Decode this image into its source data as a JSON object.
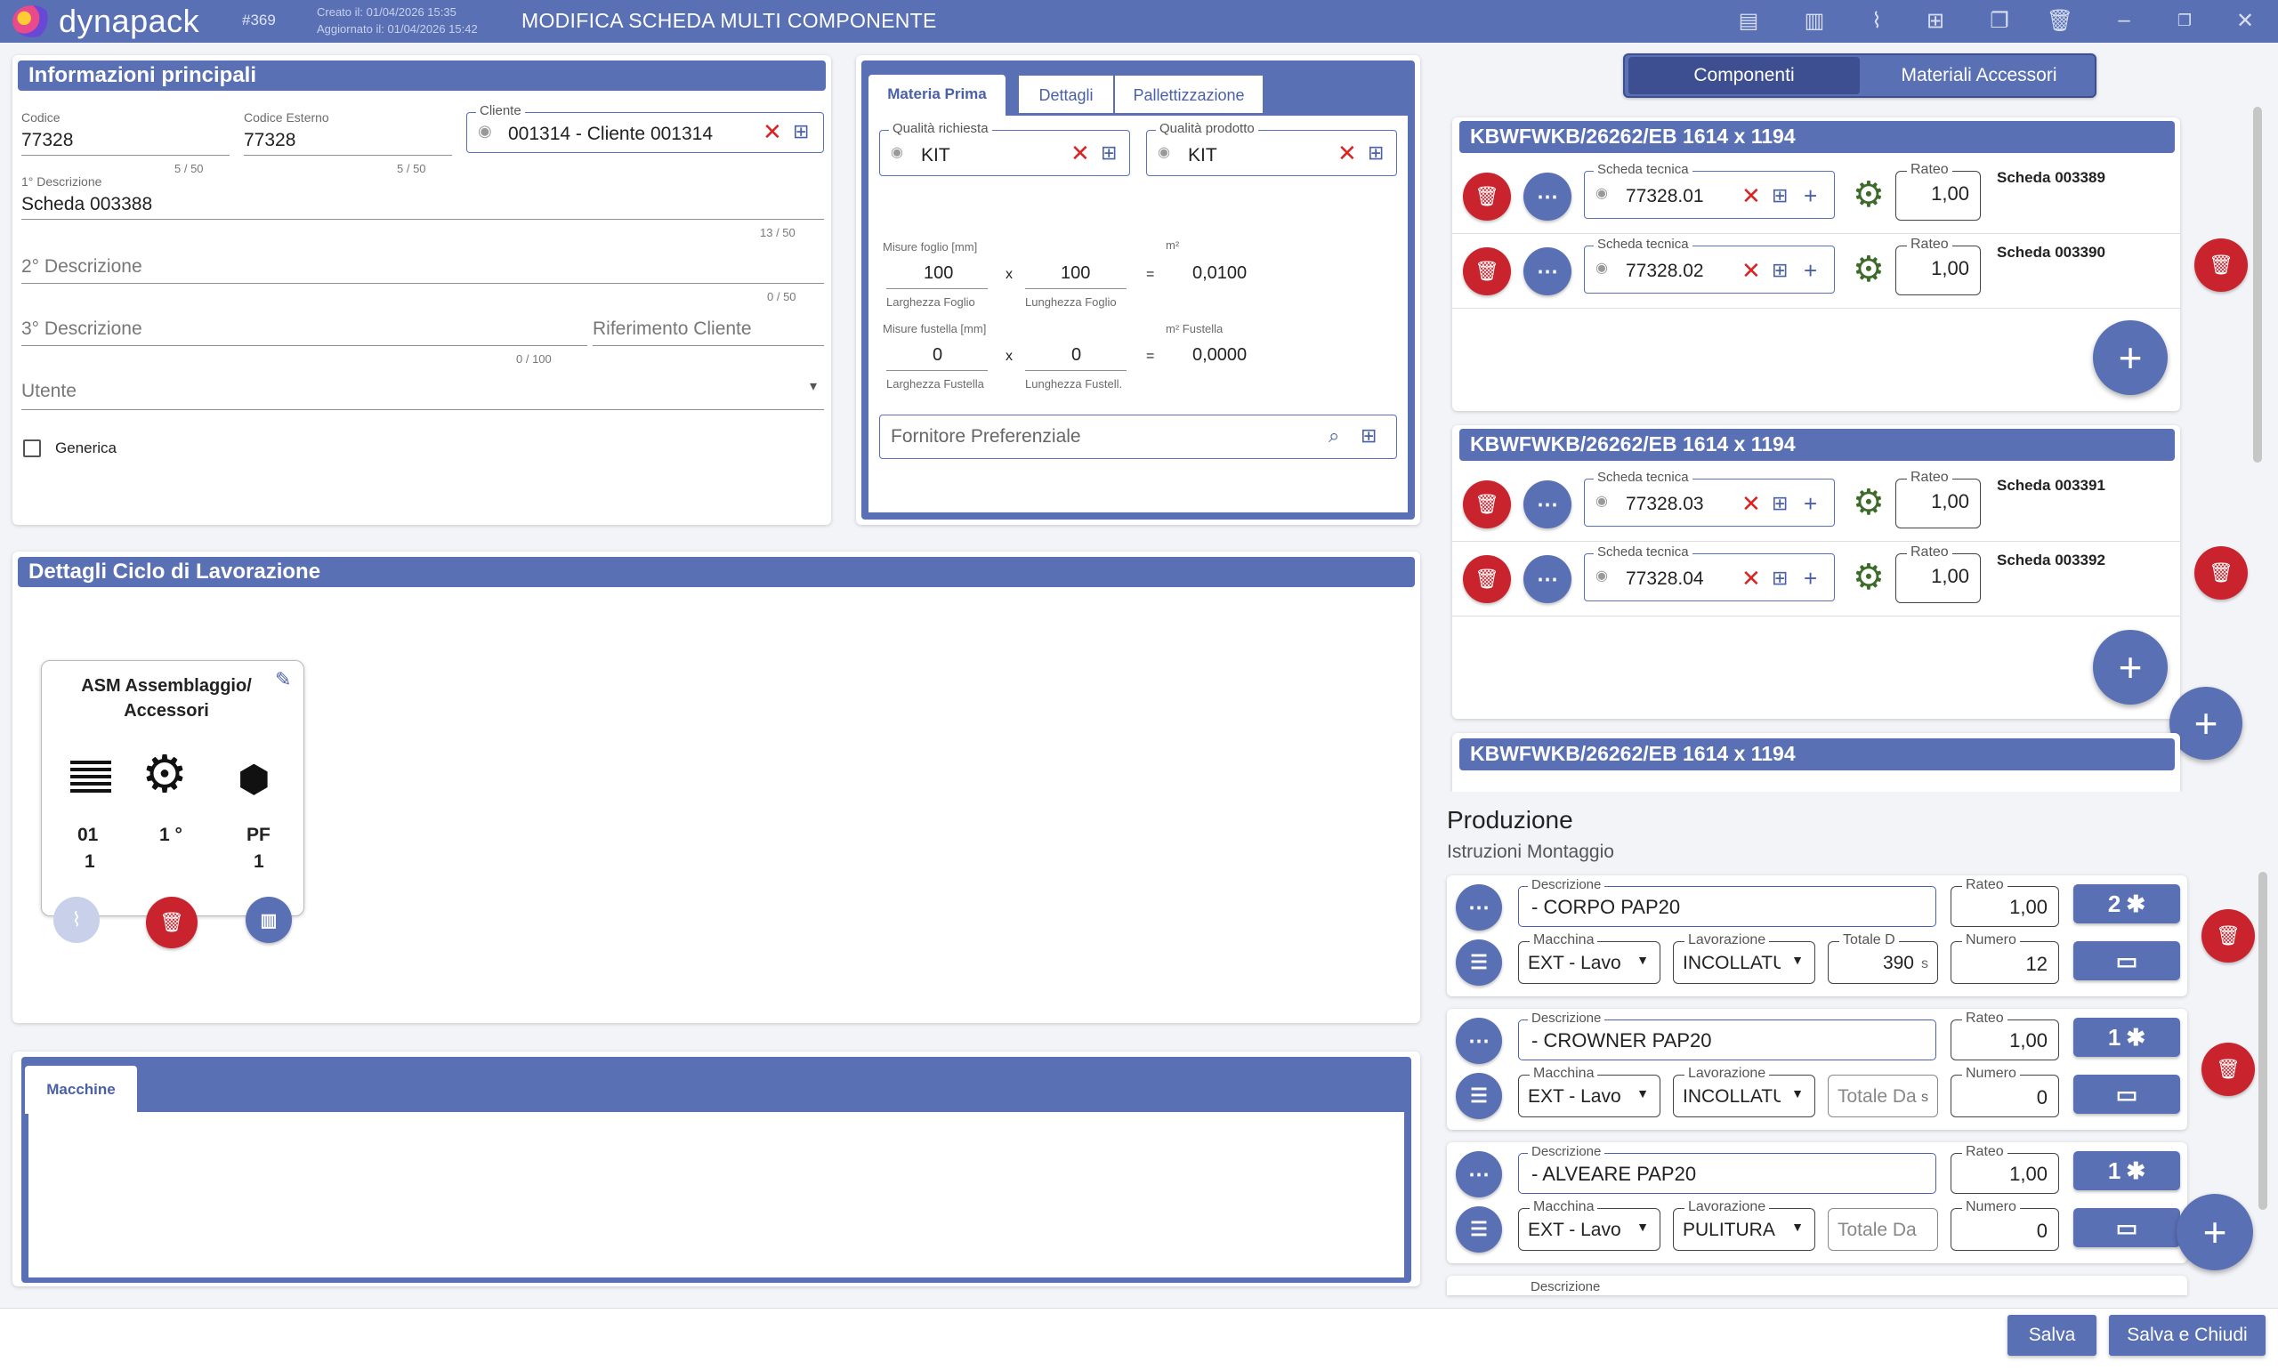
{
  "app": {
    "logo": "dynapack",
    "record_number": "#369",
    "created": "Creato il: 01/04/2026 15:35",
    "updated": "Aggiornato il: 01/04/2026 15:42",
    "title": "MODIFICA SCHEDA MULTI COMPONENTE"
  },
  "toolbar": {
    "icons": [
      "archive-icon",
      "book-icon",
      "attach-icon",
      "add-column-icon",
      "copy-icon",
      "trash-icon"
    ],
    "window": [
      "minimize-icon",
      "restore-icon",
      "close-icon"
    ]
  },
  "info": {
    "header": "Informazioni principali",
    "codice": {
      "label": "Codice",
      "value": "77328",
      "counter": "5 / 50"
    },
    "codice_esterno": {
      "label": "Codice Esterno",
      "value": "77328",
      "counter": "5 / 50"
    },
    "cliente": {
      "label": "Cliente",
      "value": "001314 - Cliente 001314"
    },
    "desc1": {
      "label": "1° Descrizione",
      "value": "Scheda 003388",
      "counter": "13 / 50"
    },
    "desc2": {
      "placeholder": "2° Descrizione",
      "counter": "0 / 50"
    },
    "desc3": {
      "placeholder": "3° Descrizione",
      "counter": "0 / 100"
    },
    "rif": {
      "placeholder": "Riferimento Cliente"
    },
    "utente": {
      "placeholder": "Utente"
    },
    "generica": "Generica"
  },
  "materia": {
    "tabs": [
      "Materia Prima",
      "Dettagli",
      "Pallettizzazione"
    ],
    "qualita_richiesta": {
      "label": "Qualità richiesta",
      "value": "KIT"
    },
    "qualita_prodotto": {
      "label": "Qualità prodotto",
      "value": "KIT"
    },
    "misure_foglio": "Misure foglio [mm]",
    "m2": "m²",
    "larghezza_foglio": {
      "value": "100",
      "label": "Larghezza Foglio"
    },
    "lunghezza_foglio": {
      "value": "100",
      "label": "Lunghezza Foglio"
    },
    "m2_foglio": "0,0100",
    "misure_fustella": "Misure fustella [mm]",
    "m2_fustella_label": "m² Fustella",
    "larghezza_fustella": {
      "value": "0",
      "label": "Larghezza Fustella"
    },
    "lunghezza_fustella": {
      "value": "0",
      "label": "Lunghezza Fustell."
    },
    "m2_fustella": "0,0000",
    "x": "x",
    "eq": "=",
    "fornitore": "Fornitore Preferenziale"
  },
  "ciclo": {
    "header": "Dettagli Ciclo di Lavorazione",
    "card": {
      "title": "ASM Assemblaggio/ Accessori",
      "cols": [
        {
          "a": "01",
          "b": "1"
        },
        {
          "a": "1 °",
          "b": ""
        },
        {
          "a": "PF",
          "b": "1"
        }
      ]
    }
  },
  "macchine": {
    "tab": "Macchine"
  },
  "right_tabs": [
    "Componenti",
    "Materiali Accessori"
  ],
  "componenti": [
    {
      "title": "KBWFWKB/26262/EB 1614 x 1194",
      "rows": [
        {
          "scheda_label": "Scheda tecnica",
          "code": "77328.01",
          "rateo_label": "Rateo",
          "rateo": "1,00",
          "scheda": "Scheda 003389"
        },
        {
          "scheda_label": "Scheda tecnica",
          "code": "77328.02",
          "rateo_label": "Rateo",
          "rateo": "1,00",
          "scheda": "Scheda 003390"
        }
      ]
    },
    {
      "title": "KBWFWKB/26262/EB 1614 x 1194",
      "rows": [
        {
          "scheda_label": "Scheda tecnica",
          "code": "77328.03",
          "rateo_label": "Rateo",
          "rateo": "1,00",
          "scheda": "Scheda 003391"
        },
        {
          "scheda_label": "Scheda tecnica",
          "code": "77328.04",
          "rateo_label": "Rateo",
          "rateo": "1,00",
          "scheda": "Scheda 003392"
        }
      ]
    },
    {
      "title": "KBWFWKB/26262/EB 1614 x 1194",
      "rows": []
    }
  ],
  "produzione": {
    "title": "Produzione",
    "subtitle": "Istruzioni Montaggio",
    "labels": {
      "descrizione": "Descrizione",
      "rateo": "Rateo",
      "macchina": "Macchina",
      "lavorazione": "Lavorazione",
      "totale": "Totale D",
      "numero": "Numero",
      "totale_ph": "Totale Da"
    },
    "rows": [
      {
        "descrizione": "- CORPO PAP20",
        "rateo": "1,00",
        "badge": "2",
        "macchina": "EXT - Lavo",
        "lavorazione": "INCOLLATU",
        "totale": "390",
        "unit": "s",
        "numero": "12"
      },
      {
        "descrizione": "- CROWNER PAP20",
        "rateo": "1,00",
        "badge": "1",
        "macchina": "EXT - Lavo",
        "lavorazione": "INCOLLATU",
        "totale": "",
        "unit": "s",
        "numero": "0"
      },
      {
        "descrizione": "- ALVEARE PAP20",
        "rateo": "1,00",
        "badge": "1",
        "macchina": "EXT - Lavo",
        "lavorazione": "PULITURA",
        "totale": "",
        "unit": "",
        "numero": "0"
      }
    ]
  },
  "footer": {
    "salva": "Salva",
    "salva_chiudi": "Salva e Chiudi"
  }
}
